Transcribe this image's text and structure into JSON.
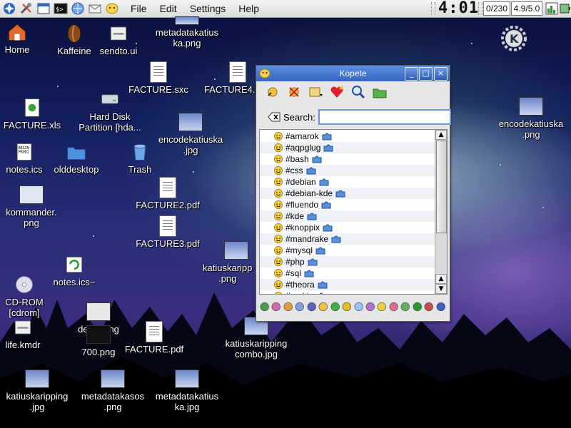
{
  "panel": {
    "launchers": [
      "kde-menu-icon",
      "tools-icon",
      "window-list-icon",
      "konsole-icon",
      "browser-icon",
      "mail-icon",
      "kopete-icon"
    ],
    "menus": [
      "File",
      "Edit",
      "Settings",
      "Help"
    ],
    "clock": "4:01",
    "counter": "0/230",
    "load": "4.9/5.0"
  },
  "desktop": {
    "icons": [
      {
        "label": "Home",
        "icon": "home-icon"
      },
      {
        "label": "Kaffeine",
        "icon": "kaffeine-icon"
      },
      {
        "label": "sendto.ui",
        "icon": "ui-file-icon"
      },
      {
        "label": "metadatakatius\nka.png",
        "icon": "image-file-icon"
      },
      {
        "label": "FACTURE.sxc",
        "icon": "document-icon"
      },
      {
        "label": "FACTURE4.",
        "icon": "document-icon"
      },
      {
        "label": "Hard Disk\nPartition [hda...",
        "icon": "hard-disk-icon"
      },
      {
        "label": "FACTURE.xls",
        "icon": "spreadsheet-icon"
      },
      {
        "label": "encodekatiuska\n.jpg",
        "icon": "image-file-icon"
      },
      {
        "label": "encodekatiuska\n.png",
        "icon": "image-file-icon"
      },
      {
        "label": "notes.ics",
        "icon": "calendar-file-icon"
      },
      {
        "label": "olddesktop",
        "icon": "folder-icon"
      },
      {
        "label": "Trash",
        "icon": "trash-icon"
      },
      {
        "label": "kommander.\npng",
        "icon": "image-file-icon"
      },
      {
        "label": "FACTURE2.pdf",
        "icon": "pdf-icon"
      },
      {
        "label": "FACTURE3.pdf",
        "icon": "pdf-icon"
      },
      {
        "label": "katiuskaripp\n.png",
        "icon": "image-file-icon"
      },
      {
        "label": "notes.ics~",
        "icon": "backup-file-icon"
      },
      {
        "label": "CD-ROM\n[cdrom]",
        "icon": "cdrom-icon"
      },
      {
        "label": "derek.png",
        "icon": "image-file-icon"
      },
      {
        "label": "life.kmdr",
        "icon": "kommander-file-icon"
      },
      {
        "label": "700.png",
        "icon": "image-file-icon"
      },
      {
        "label": "FACTURE.pdf",
        "icon": "pdf-icon"
      },
      {
        "label": "katiuskaripping\ncombo.jpg",
        "icon": "image-file-icon"
      },
      {
        "label": "katiuskaripping\n.jpg",
        "icon": "image-file-icon"
      },
      {
        "label": "metadatakasos\n.png",
        "icon": "image-file-icon"
      },
      {
        "label": "metadatakatius\nka.jpg",
        "icon": "image-file-icon"
      }
    ]
  },
  "kopete": {
    "title": "Kopete",
    "toolbar": [
      "connect-icon",
      "disconnect-icon",
      "status-icon",
      "add-contact-icon",
      "search-icon",
      "open-folder-icon"
    ],
    "search_label": "Search:",
    "search_value": "",
    "contacts": [
      "#amarok",
      "#aqpglug",
      "#bash",
      "#css",
      "#debian",
      "#debian-kde",
      "#fluendo",
      "#kde",
      "#knoppix",
      "#mandrake",
      "#mysql",
      "#php",
      "#sql",
      "#theora",
      "#vorbis"
    ],
    "minimize": "_",
    "maximize": "□",
    "close": "×"
  }
}
